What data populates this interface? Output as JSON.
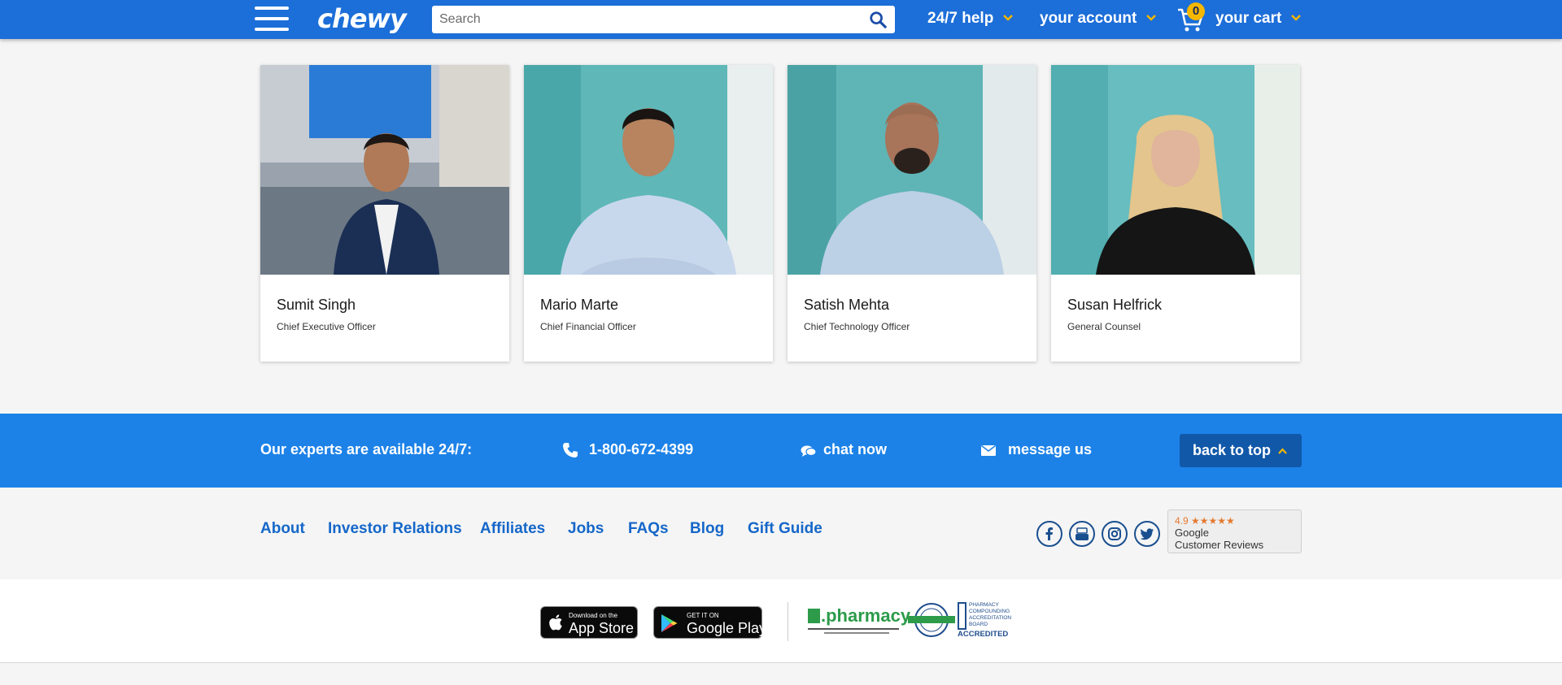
{
  "header": {
    "logo": "chewy",
    "search_placeholder": "Search",
    "help_label": "24/7 help",
    "account_label": "your account",
    "cart_label": "your cart",
    "cart_count": "0"
  },
  "leaders": [
    {
      "name": "Sumit Singh",
      "title": "Chief Executive Officer"
    },
    {
      "name": "Mario Marte",
      "title": "Chief Financial Officer"
    },
    {
      "name": "Satish Mehta",
      "title": "Chief Technology Officer"
    },
    {
      "name": "Susan Helfrick",
      "title": "General Counsel"
    }
  ],
  "contact": {
    "experts_label": "Our experts are available 24/7:",
    "phone": "1-800-672-4399",
    "chat_label": "chat now",
    "message_label": "message us",
    "back_to_top_label": "back to top"
  },
  "footer_links": [
    "About",
    "Investor Relations",
    "Affiliates",
    "Jobs",
    "FAQs",
    "Blog",
    "Gift Guide"
  ],
  "reviews": {
    "rating": "4.9 ★★★★★",
    "source": "Google",
    "label": "Customer Reviews"
  },
  "apps": {
    "app_store_small": "Download on the",
    "app_store_big": "App Store",
    "google_small": "GET IT ON",
    "google_big": "Google Play"
  },
  "badges": {
    "pharmacy": ".pharmacy",
    "pcab_lines": "PHARMACY COMPOUNDING ACCREDITATION BOARD",
    "pcab_accredited": "ACCREDITED"
  },
  "colors": {
    "header_blue": "#1c6ed8",
    "band_blue": "#1c82e8",
    "link_blue": "#1567c9",
    "accent_yellow": "#f5b700"
  }
}
